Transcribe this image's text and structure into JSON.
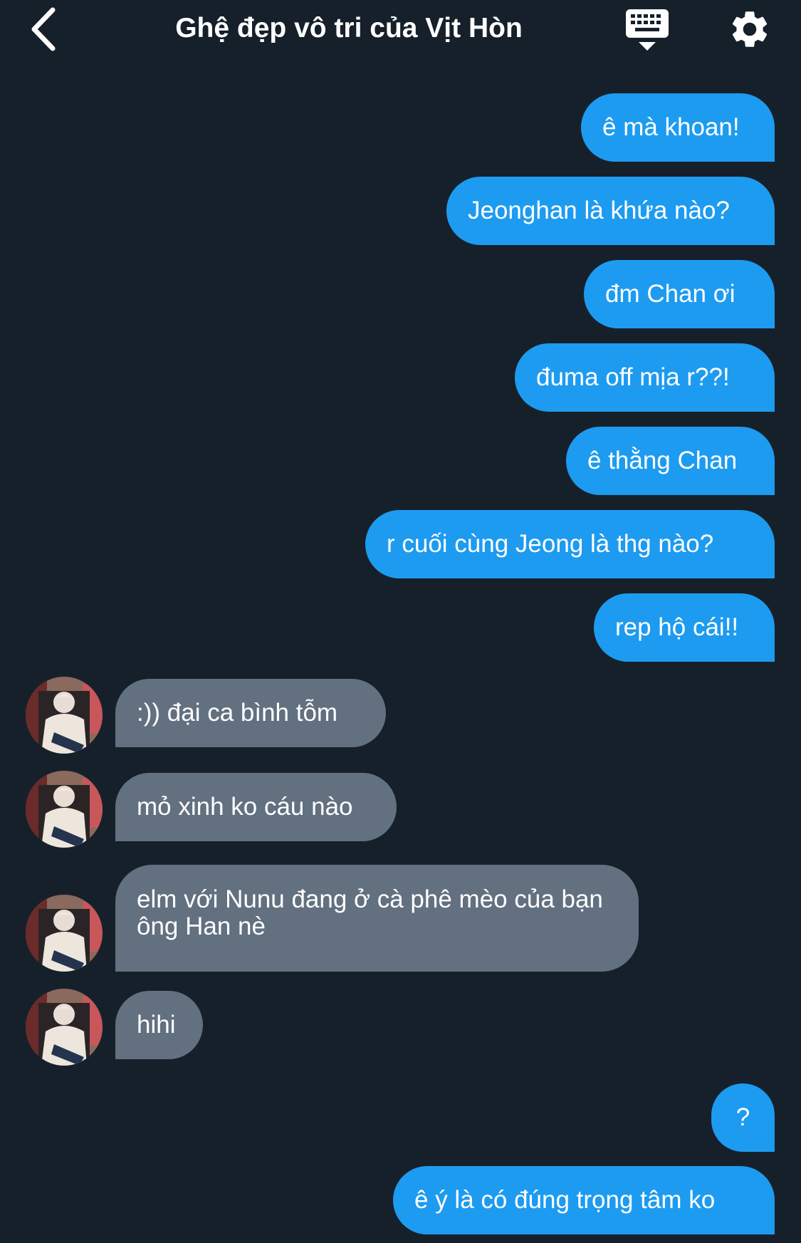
{
  "header": {
    "title": "Ghệ đẹp vô tri của Vịt Hòn",
    "back_icon": "chevron-left-icon",
    "keyboard_icon": "keyboard-icon",
    "settings_icon": "gear-icon"
  },
  "colors": {
    "background": "#16202b",
    "outgoing_bubble": "#1d9bf0",
    "incoming_bubble": "#627080",
    "text": "#ffffff"
  },
  "messages": [
    {
      "direction": "out",
      "text": "ê mà khoan!"
    },
    {
      "direction": "out",
      "text": "Jeonghan là khứa nào?"
    },
    {
      "direction": "out",
      "text": "đm Chan ơi"
    },
    {
      "direction": "out",
      "text": "đuma off mịa r??!"
    },
    {
      "direction": "out",
      "text": "ê thằng Chan"
    },
    {
      "direction": "out",
      "text": "r cuối cùng Jeong là thg nào?"
    },
    {
      "direction": "out",
      "text": "rep hộ cái!!"
    },
    {
      "direction": "in",
      "text": ":)) đại ca bình tỗm"
    },
    {
      "direction": "in",
      "text": "mỏ xinh ko cáu nào"
    },
    {
      "direction": "in",
      "text": "elm với Nunu đang ở cà phê mèo của bạn ông Han nè"
    },
    {
      "direction": "in",
      "text": "hihi"
    },
    {
      "direction": "out",
      "text": "?"
    },
    {
      "direction": "out",
      "text": "ê ý là có đúng trọng tâm ko"
    }
  ]
}
